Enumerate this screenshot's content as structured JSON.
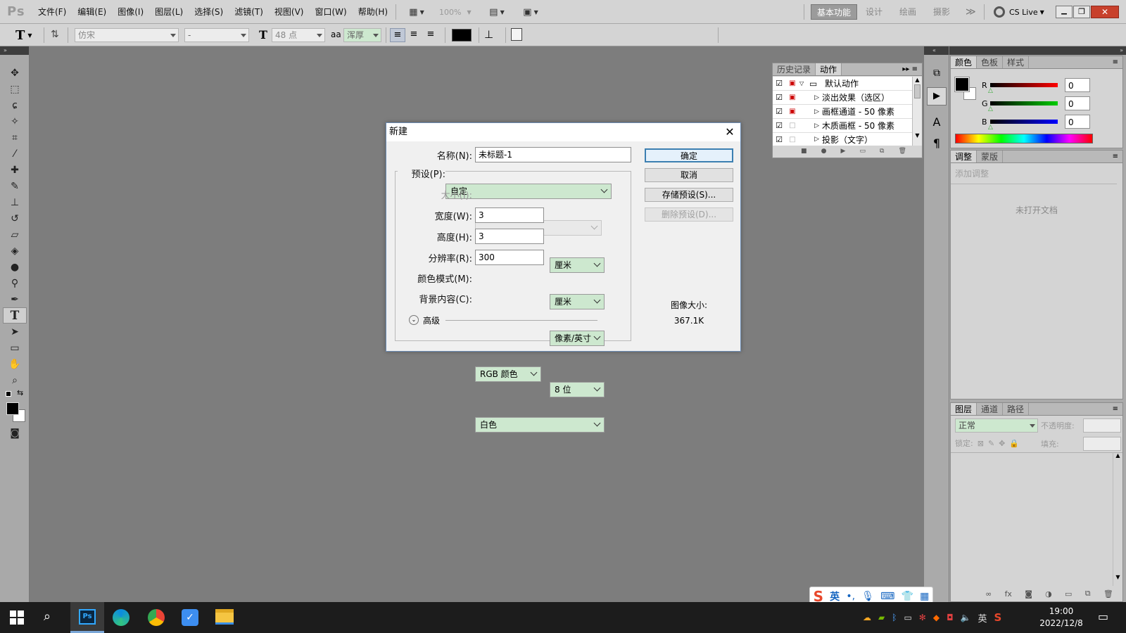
{
  "app": {
    "logo": "Ps"
  },
  "menu": [
    "文件(F)",
    "编辑(E)",
    "图像(I)",
    "图层(L)",
    "选择(S)",
    "滤镜(T)",
    "视图(V)",
    "窗口(W)",
    "帮助(H)"
  ],
  "zoom": "100%",
  "workspaces": {
    "basic": "基本功能",
    "design": "设计",
    "painting": "绘画",
    "photo": "摄影",
    "more": "≫"
  },
  "cslive": "CS Live",
  "options": {
    "font": "仿宋",
    "style": "-",
    "size": "48 点",
    "aa_icon": "aa",
    "aa": "浑厚"
  },
  "history_panel": {
    "tabs": [
      "历史记录",
      "动作"
    ],
    "items": [
      "默认动作",
      "淡出效果（选区）",
      "画框通道 - 50 像素",
      "木质画框 - 50 像素",
      "投影（文字）"
    ]
  },
  "color_panel": {
    "tabs": [
      "颜色",
      "色板",
      "样式"
    ],
    "channels": [
      {
        "name": "R",
        "value": "0"
      },
      {
        "name": "G",
        "value": "0"
      },
      {
        "name": "B",
        "value": "0"
      }
    ]
  },
  "adjust_panel": {
    "tabs": [
      "调整",
      "蒙版"
    ],
    "add": "添加调整",
    "empty": "未打开文档"
  },
  "layers_panel": {
    "tabs": [
      "图层",
      "通道",
      "路径"
    ],
    "mode": "正常",
    "opacity": "不透明度:",
    "lock": "锁定:",
    "fill": "填充:"
  },
  "dialog": {
    "title": "新建",
    "name_label": "名称(N):",
    "name_value": "未标题-1",
    "preset_label": "预设(P):",
    "preset_value": "自定",
    "size_label": "大小(I):",
    "width_label": "宽度(W):",
    "width_value": "3",
    "width_unit": "厘米",
    "height_label": "高度(H):",
    "height_value": "3",
    "height_unit": "厘米",
    "res_label": "分辨率(R):",
    "res_value": "300",
    "res_unit": "像素/英寸",
    "mode_label": "颜色模式(M):",
    "mode_value": "RGB 颜色",
    "depth_value": "8 位",
    "bg_label": "背景内容(C):",
    "bg_value": "白色",
    "advanced": "高级",
    "ok": "确定",
    "cancel": "取消",
    "save_preset": "存储预设(S)...",
    "delete_preset": "删除预设(D)...",
    "img_size_label": "图像大小:",
    "img_size_value": "367.1K"
  },
  "ime": {
    "lang": "英"
  },
  "taskbar": {
    "lang": "英",
    "time": "19:00",
    "date": "2022/12/8"
  }
}
